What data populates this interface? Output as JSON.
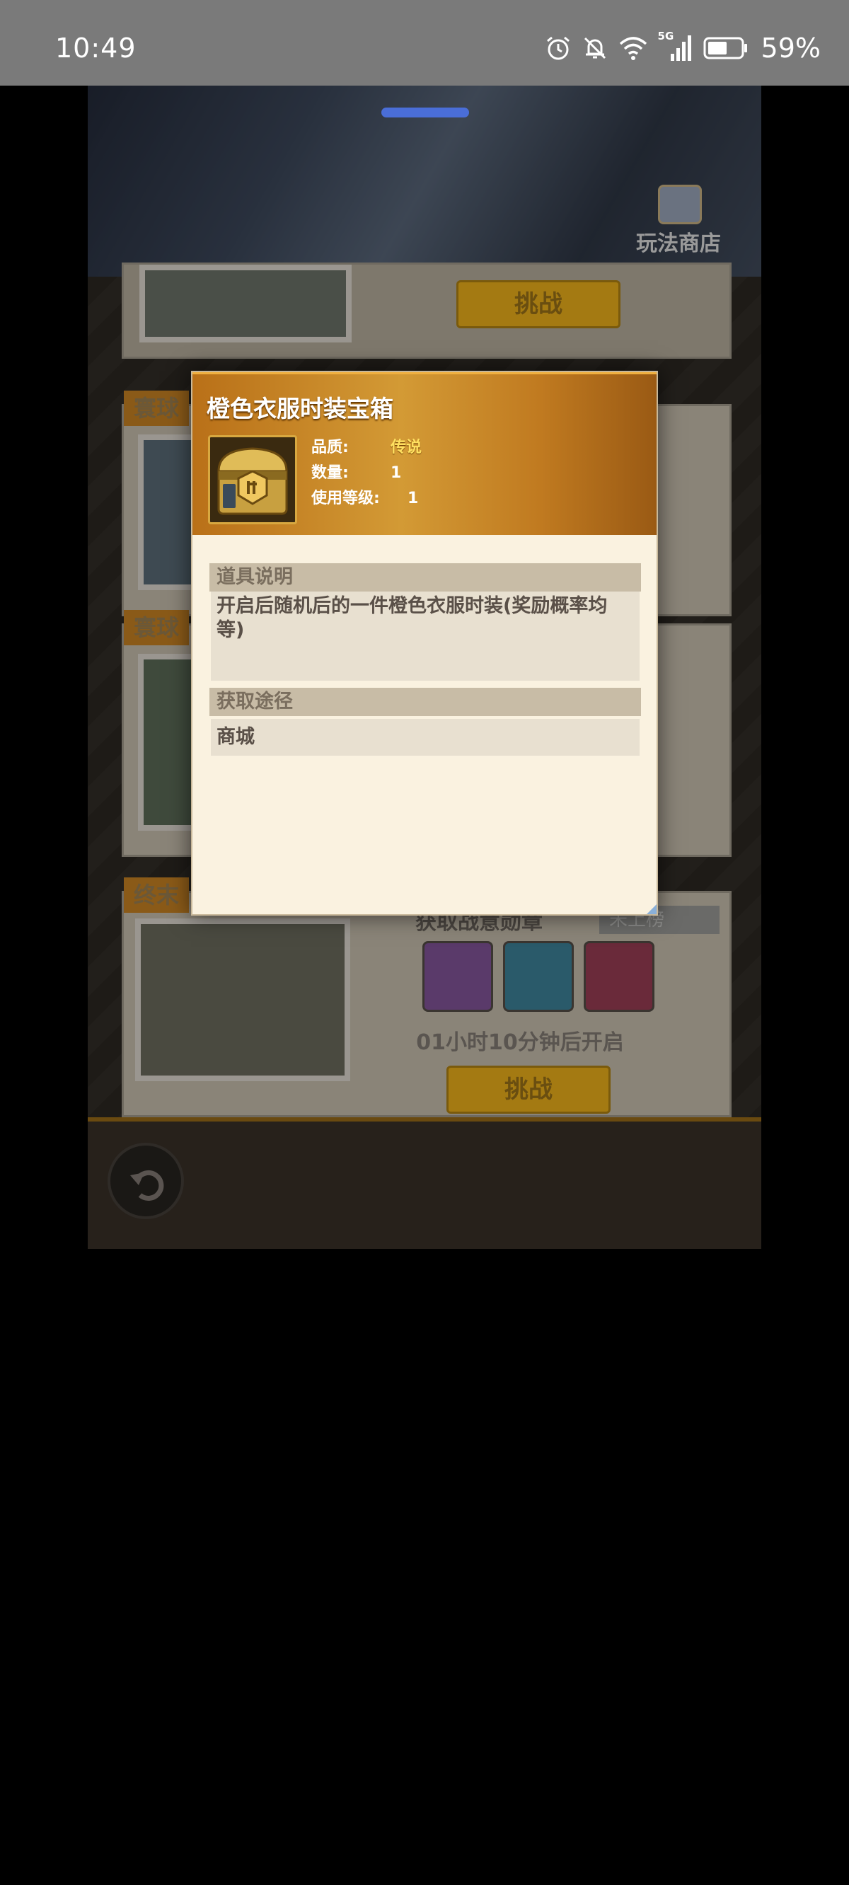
{
  "status_bar": {
    "time": "10:49",
    "battery_percent": "59%",
    "network_label": "5G",
    "icons": [
      "alarm-icon",
      "mute-icon",
      "wifi-icon",
      "signal-icon",
      "battery-icon"
    ]
  },
  "game": {
    "shop_label": "玩法商店",
    "cards": [
      {
        "challenge_label": "挑战"
      },
      {
        "tag": "寰球"
      },
      {
        "tag": "寰球"
      },
      {
        "tag": "终末",
        "reward_label": "获取战意勋章",
        "rank_label": "未上榜",
        "countdown": "01小时10分钟后开启",
        "challenge_label": "挑战"
      }
    ]
  },
  "modal": {
    "title": "橙色衣服时装宝箱",
    "attributes": [
      {
        "key": "品质:",
        "value": "传说"
      },
      {
        "key": "数量:",
        "value": "1"
      },
      {
        "key": "使用等级:",
        "value": "1"
      }
    ],
    "description_header": "道具说明",
    "description": "开启后随机后的一件橙色衣服时装(奖励概率均等)",
    "source_header": "获取途径",
    "source": "商城"
  },
  "colors": {
    "modal_header": "#c8852a",
    "modal_body": "#faf2e0",
    "quality_legendary": "#ffe060",
    "drag_handle": "#4a6ed8"
  }
}
